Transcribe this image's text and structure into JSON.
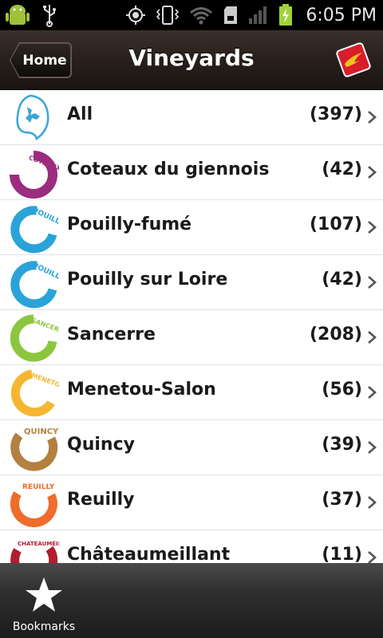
{
  "status_bar": {
    "time": "6:05 PM",
    "icons": [
      "android-icon",
      "usb-icon",
      "gps-icon",
      "vibrate-icon",
      "wifi-icon",
      "sd-card-icon",
      "signal-icon",
      "battery-charging-icon"
    ]
  },
  "header": {
    "back_label": "Home",
    "title": "Vineyards",
    "logo_icon": "brand-logo-icon"
  },
  "list": {
    "items": [
      {
        "label": "All",
        "count": "(397)",
        "icon": "all-vineyards-icon"
      },
      {
        "label": "Coteaux du giennois",
        "count": "(42)",
        "icon": "coteaux-du-giennois-logo",
        "logo_text": "COTEAUX DU GIENNOIS"
      },
      {
        "label": "Pouilly-fumé",
        "count": "(107)",
        "icon": "pouilly-logo",
        "logo_text": "POUILLY"
      },
      {
        "label": "Pouilly sur Loire",
        "count": "(42)",
        "icon": "pouilly-logo",
        "logo_text": "POUILLY"
      },
      {
        "label": "Sancerre",
        "count": "(208)",
        "icon": "sancerre-logo",
        "logo_text": "SANCERRE"
      },
      {
        "label": "Menetou-Salon",
        "count": "(56)",
        "icon": "menetou-salon-logo",
        "logo_text": "MENETOU SALON"
      },
      {
        "label": "Quincy",
        "count": "(39)",
        "icon": "quincy-logo",
        "logo_text": "QUINCY"
      },
      {
        "label": "Reuilly",
        "count": "(37)",
        "icon": "reuilly-logo",
        "logo_text": "REUILLY"
      },
      {
        "label": "Châteaumeillant",
        "count": "(11)",
        "icon": "chateaumeillant-logo",
        "logo_text": "CHATEAUMEILLANT"
      }
    ]
  },
  "tabbar": {
    "bookmarks_label": "Bookmarks",
    "bookmarks_icon": "star-icon"
  },
  "colors": {
    "pouilly": "#2aa3d8",
    "sancerre": "#8cc63f",
    "menetou": "#f5b731",
    "quincy": "#b38040",
    "reuilly": "#ef6c2a",
    "coteaux": "#9b2c7e",
    "chateaumeillant": "#b01e2e"
  }
}
